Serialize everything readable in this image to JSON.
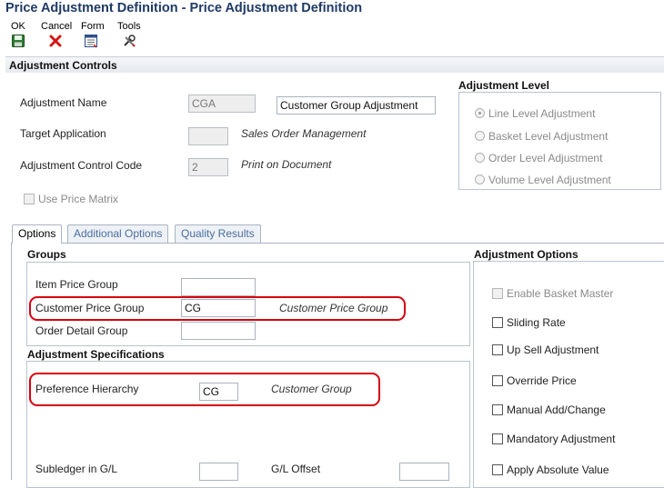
{
  "window": {
    "title": "Price Adjustment Definition - Price Adjustment Definition"
  },
  "toolbar": {
    "ok": {
      "label": "OK",
      "icon": "save-disk-icon"
    },
    "cancel": {
      "label": "Cancel",
      "icon": "red-x-icon"
    },
    "form": {
      "label": "Form",
      "icon": "form-menu-icon"
    },
    "tools": {
      "label": "Tools",
      "icon": "tools-icon"
    }
  },
  "adjustment_controls": {
    "header": "Adjustment Controls",
    "adjustment_name_label": "Adjustment Name",
    "adjustment_name_code": "CGA",
    "adjustment_name_description": "Customer Group Adjustment",
    "target_application_label": "Target Application",
    "target_application_code": "",
    "target_application_description": "Sales Order Management",
    "control_code_label": "Adjustment Control Code",
    "control_code_value": "2",
    "control_code_description": "Print on Document",
    "use_price_matrix_label": "Use Price Matrix",
    "use_price_matrix_checked": false
  },
  "adjustment_level": {
    "header": "Adjustment Level",
    "options": [
      {
        "label": "Line Level Adjustment",
        "selected": true
      },
      {
        "label": "Basket Level Adjustment",
        "selected": false
      },
      {
        "label": "Order Level Adjustment",
        "selected": false
      },
      {
        "label": "Volume Level Adjustment",
        "selected": false
      }
    ]
  },
  "tabs": [
    {
      "label": "Options",
      "active": true
    },
    {
      "label": "Additional Options",
      "active": false
    },
    {
      "label": "Quality Results",
      "active": false
    }
  ],
  "groups": {
    "header": "Groups",
    "item_price_group_label": "Item Price Group",
    "item_price_group_value": "",
    "customer_price_group_label": "Customer Price Group",
    "customer_price_group_value": "CG",
    "customer_price_group_description": "Customer Price Group",
    "order_detail_group_label": "Order Detail Group",
    "order_detail_group_value": ""
  },
  "adjustment_specifications": {
    "header": "Adjustment Specifications",
    "preference_hierarchy_label": "Preference Hierarchy",
    "preference_hierarchy_value": "CG",
    "preference_hierarchy_description": "Customer Group",
    "subledger_label": "Subledger in G/L",
    "subledger_value": "",
    "gl_offset_label": "G/L Offset",
    "gl_offset_value": ""
  },
  "adjustment_options": {
    "header": "Adjustment Options",
    "items": [
      {
        "label": "Enable Basket Master",
        "checked": false,
        "disabled": true
      },
      {
        "label": "Sliding Rate",
        "checked": false,
        "disabled": false
      },
      {
        "label": "Up Sell Adjustment",
        "checked": false,
        "disabled": false
      },
      {
        "label": "Override Price",
        "checked": false,
        "disabled": false
      },
      {
        "label": "Manual Add/Change",
        "checked": false,
        "disabled": false
      },
      {
        "label": "Mandatory Adjustment",
        "checked": false,
        "disabled": false
      },
      {
        "label": "Apply Absolute Value",
        "checked": false,
        "disabled": false
      }
    ]
  },
  "colors": {
    "title": "#1f3a66",
    "highlight": "#d8000f",
    "tab_inactive_text": "#4a6ea0"
  }
}
